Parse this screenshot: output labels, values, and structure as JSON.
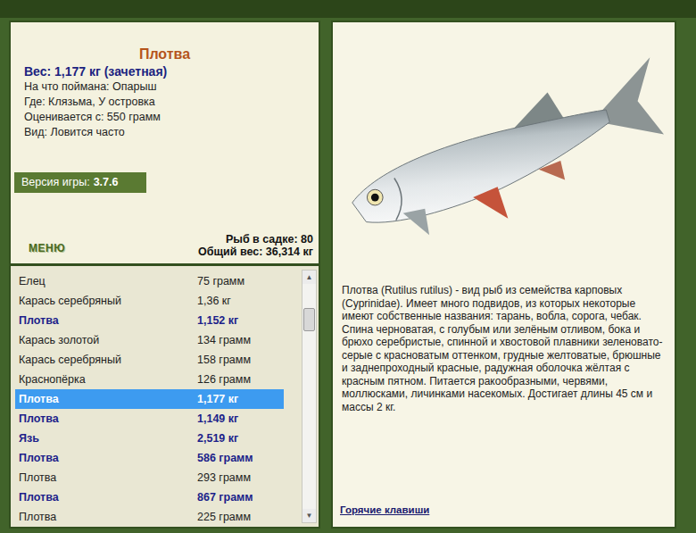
{
  "fish_card": {
    "title": "Плотва",
    "weight": "Вес: 1,177 кг (зачетная)",
    "details": [
      "На что поймана: Опарыш",
      "Где: Клязьма, У островка",
      "Оценивается с: 550 грамм",
      "Вид: Ловится часто"
    ]
  },
  "version": {
    "label": "Версия игры:",
    "value": "3.7.6"
  },
  "menu_button": "МЕНЮ",
  "keepnet": {
    "count": "Рыб в садке: 80",
    "total": "Общий вес: 36,314 кг"
  },
  "catch_list": {
    "items": [
      {
        "name": "Елец",
        "weight": "75 грамм",
        "trophy": false,
        "selected": false
      },
      {
        "name": "Карась серебряный",
        "weight": "1,36 кг",
        "trophy": false,
        "selected": false
      },
      {
        "name": "Плотва",
        "weight": "1,152 кг",
        "trophy": true,
        "selected": false
      },
      {
        "name": "Карась золотой",
        "weight": "134 грамм",
        "trophy": false,
        "selected": false
      },
      {
        "name": "Карась серебряный",
        "weight": "158 грамм",
        "trophy": false,
        "selected": false
      },
      {
        "name": "Краснопёрка",
        "weight": "126 грамм",
        "trophy": false,
        "selected": false
      },
      {
        "name": "Плотва",
        "weight": "1,177 кг",
        "trophy": true,
        "selected": true
      },
      {
        "name": "Плотва",
        "weight": "1,149 кг",
        "trophy": true,
        "selected": false
      },
      {
        "name": "Язь",
        "weight": "2,519 кг",
        "trophy": true,
        "selected": false
      },
      {
        "name": "Плотва",
        "weight": "586 грамм",
        "trophy": true,
        "selected": false
      },
      {
        "name": "Плотва",
        "weight": "293 грамм",
        "trophy": false,
        "selected": false
      },
      {
        "name": "Плотва",
        "weight": "867 грамм",
        "trophy": true,
        "selected": false
      },
      {
        "name": "Плотва",
        "weight": "225 грамм",
        "trophy": false,
        "selected": false
      }
    ],
    "scrollbar": {
      "up": "▲",
      "down": "▼",
      "level": 0.12
    }
  },
  "description": "Плотва (Rutilus rutilus) - вид рыб из семейства карповых (Cyprinidae). Имеет много подвидов, из которых некоторые имеют собственные названия: тарань, вобла, сорога, чебак. Спина черноватая, с голубым или зелёным отливом, бока и брюхо серебристые, спинной и хвостовой плавники зеленовато-серые с красноватым оттенком, грудные желтоватые, брюшные и заднепроходный красные, радужная оболочка жёлтая с красным пятном. Питается ракообразными, червями, моллюсками, личинками насекомых. Достигает длины 45 см и массы 2 кг.",
  "hotkeys_link": "Горячие клавиши"
}
